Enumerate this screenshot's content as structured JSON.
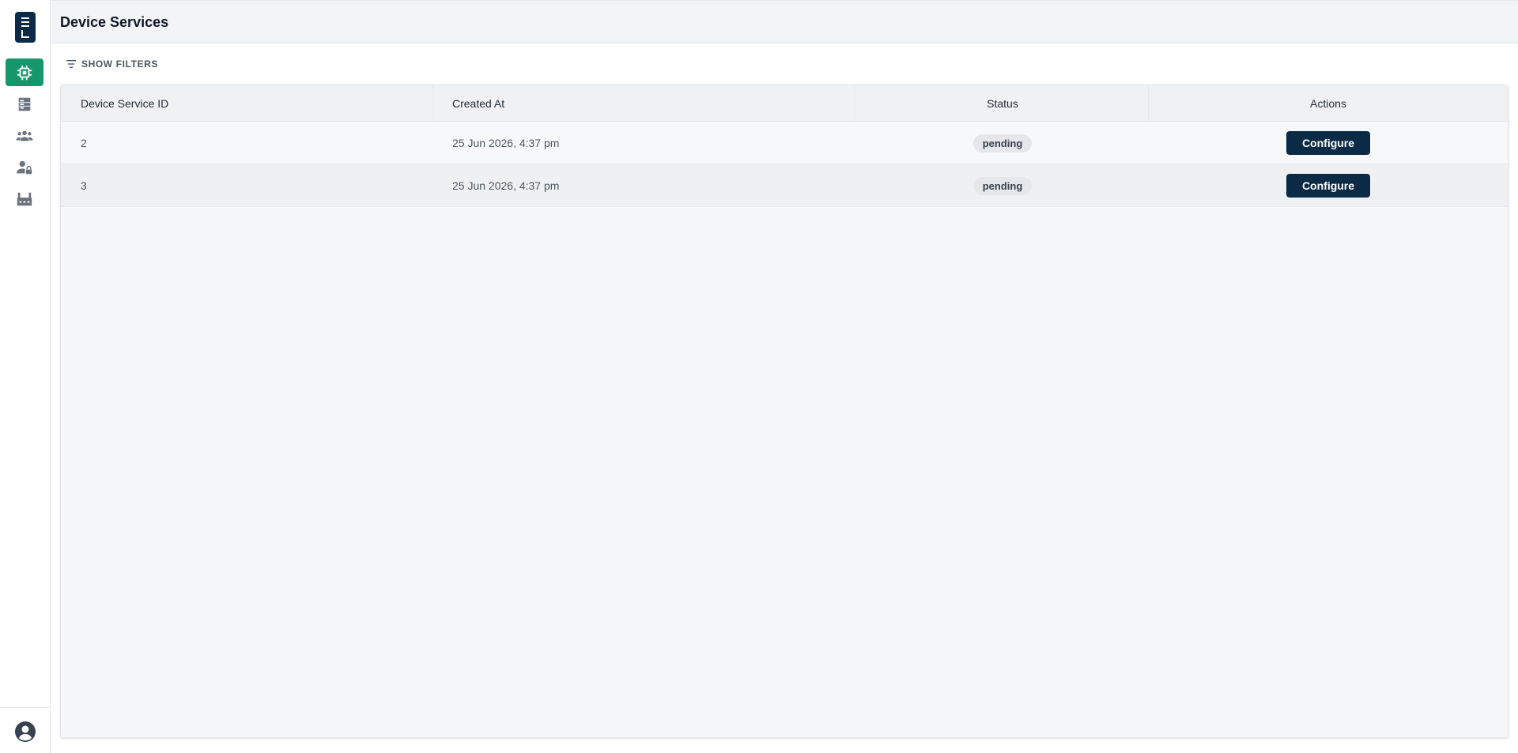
{
  "header": {
    "title": "Device Services"
  },
  "toolbar": {
    "show_filters_label": "SHOW FILTERS"
  },
  "sidebar": {
    "items": [
      {
        "icon": "chip-icon",
        "active": true
      },
      {
        "icon": "server-icon",
        "active": false
      },
      {
        "icon": "users-group-icon",
        "active": false
      },
      {
        "icon": "user-lock-icon",
        "active": false
      },
      {
        "icon": "factory-icon",
        "active": false
      }
    ],
    "footer_icon": "account-circle-icon"
  },
  "table": {
    "columns": [
      "Device Service ID",
      "Created At",
      "Status",
      "Actions"
    ],
    "rows": [
      {
        "id": "2",
        "created_at": "25 Jun 2026, 4:37 pm",
        "status": "pending",
        "action": "Configure"
      },
      {
        "id": "3",
        "created_at": "25 Jun 2026, 4:37 pm",
        "status": "pending",
        "action": "Configure"
      }
    ]
  },
  "colors": {
    "brand_dark": "#0b2a45",
    "active_nav": "#16966b",
    "badge_bg": "#e5e7eb"
  }
}
